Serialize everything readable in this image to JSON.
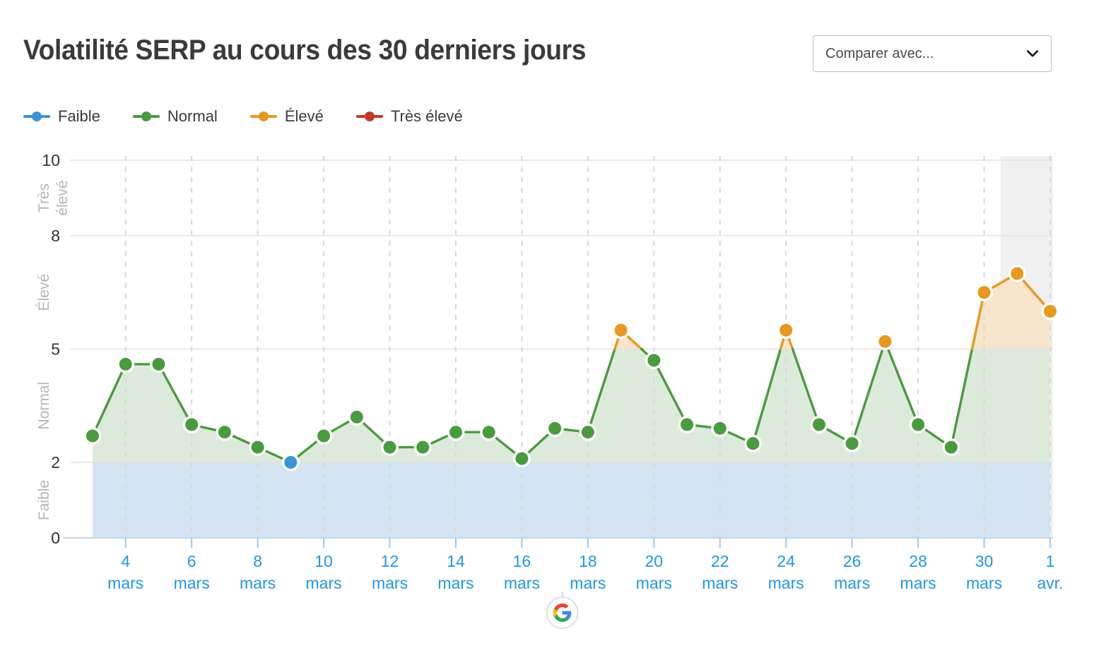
{
  "header": {
    "title": "Volatilité SERP au cours des 30 derniers jours",
    "compare_label": "Comparer avec...",
    "chevron_icon": "chevron-down-icon"
  },
  "legend": [
    {
      "label": "Faible",
      "color": "#3b93d4"
    },
    {
      "label": "Normal",
      "color": "#4a9a3f"
    },
    {
      "label": "Élevé",
      "color": "#e8981f"
    },
    {
      "label": "Très élevé",
      "color": "#c1392b"
    }
  ],
  "source": {
    "icon": "google-logo-icon",
    "name": "Google"
  },
  "chart_data": {
    "type": "line",
    "title": "Volatilité SERP au cours des 30 derniers jours",
    "xlabel": "",
    "ylabel": "",
    "ylim": [
      0,
      10
    ],
    "yticks": [
      0,
      2,
      5,
      8,
      10
    ],
    "grid": true,
    "legend_position": "top-left",
    "bands": [
      {
        "label": "Faible",
        "from": 0,
        "to": 2,
        "fill": "#d5e4f2",
        "text_color": "#b5b5b5"
      },
      {
        "label": "Normal",
        "from": 2,
        "to": 5,
        "fill": "#dceadb",
        "text_color": "#b5b5b5"
      },
      {
        "label": "Élevé",
        "from": 5,
        "to": 8,
        "fill": "#f7e4cc",
        "text_color": "#b5b5b5"
      },
      {
        "label": "Très élevé",
        "from": 8,
        "to": 10,
        "fill": "#f2d6d2",
        "text_color": "#b5b5b5"
      }
    ],
    "x_tick_labels": [
      {
        "index": 1,
        "day": "4",
        "month": "mars"
      },
      {
        "index": 3,
        "day": "6",
        "month": "mars"
      },
      {
        "index": 5,
        "day": "8",
        "month": "mars"
      },
      {
        "index": 7,
        "day": "10",
        "month": "mars"
      },
      {
        "index": 9,
        "day": "12",
        "month": "mars"
      },
      {
        "index": 11,
        "day": "14",
        "month": "mars"
      },
      {
        "index": 13,
        "day": "16",
        "month": "mars"
      },
      {
        "index": 15,
        "day": "18",
        "month": "mars"
      },
      {
        "index": 17,
        "day": "20",
        "month": "mars"
      },
      {
        "index": 19,
        "day": "22",
        "month": "mars"
      },
      {
        "index": 21,
        "day": "24",
        "month": "mars"
      },
      {
        "index": 23,
        "day": "26",
        "month": "mars"
      },
      {
        "index": 25,
        "day": "28",
        "month": "mars"
      },
      {
        "index": 27,
        "day": "30",
        "month": "mars"
      },
      {
        "index": 29,
        "day": "1",
        "month": "avr."
      }
    ],
    "categories": [
      "3 mars",
      "4 mars",
      "5 mars",
      "6 mars",
      "7 mars",
      "8 mars",
      "9 mars",
      "10 mars",
      "11 mars",
      "12 mars",
      "13 mars",
      "14 mars",
      "15 mars",
      "16 mars",
      "17 mars",
      "18 mars",
      "19 mars",
      "20 mars",
      "21 mars",
      "22 mars",
      "23 mars",
      "24 mars",
      "25 mars",
      "26 mars",
      "27 mars",
      "28 mars",
      "29 mars",
      "30 mars",
      "31 mars",
      "1 avr."
    ],
    "values": [
      2.7,
      4.6,
      4.6,
      3.0,
      2.8,
      2.4,
      2.0,
      2.7,
      3.2,
      2.4,
      2.4,
      2.8,
      2.8,
      2.1,
      2.9,
      2.8,
      5.5,
      4.7,
      3.0,
      2.9,
      2.5,
      5.5,
      3.0,
      2.5,
      5.2,
      3.0,
      2.4,
      6.5,
      7.0,
      6.0
    ],
    "highlight_range": {
      "from_index": 28.5,
      "to_index": 30,
      "fill": "#f0f0f0"
    },
    "thresholds": {
      "faible_max": 2,
      "normal_max": 5,
      "eleve_max": 8
    },
    "colors": {
      "low": "#3b93d4",
      "normal": "#4a9a3f",
      "high": "#e8981f",
      "very_high": "#c1392b",
      "area_normal": "#dceadb",
      "area_high": "#f7e4cc",
      "area_low": "#d5e4f2",
      "axis_text": "#333333",
      "x_label": "#2196e8",
      "gridline": "#dddddd"
    }
  }
}
